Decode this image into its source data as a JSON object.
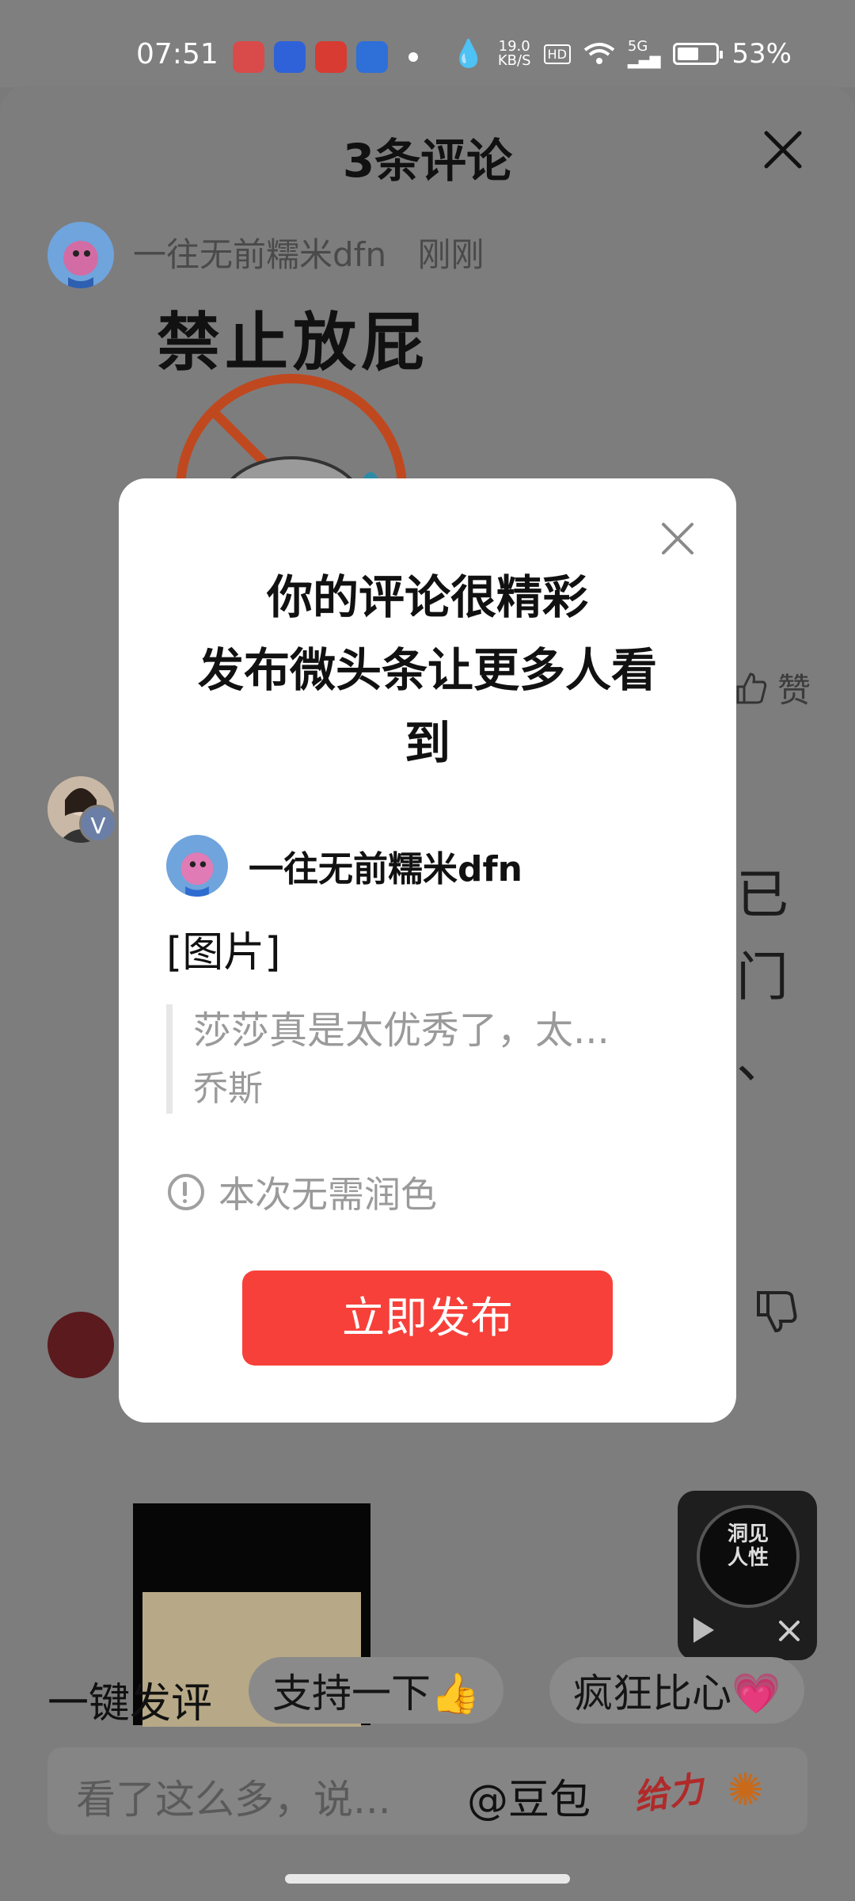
{
  "status_bar": {
    "time": "07:51",
    "net_speed": "19.0",
    "net_speed_unit": "KB/S",
    "hd": "HD",
    "signal": "5G",
    "battery": "53%"
  },
  "sheet": {
    "title": "3条评论",
    "comments": [
      {
        "author": "一往无前糯米dfn",
        "time": "刚刚",
        "sticker_text": "禁止放屁"
      }
    ],
    "like_label": "赞",
    "partial_chars": [
      "已",
      "门",
      "、"
    ]
  },
  "dialog": {
    "title_line1": "你的评论很精彩",
    "title_line2": "发布微头条让更多人看",
    "title_line3": "到",
    "username": "一往无前糯米dfn",
    "content": "[图片]",
    "quote_text": "莎莎真是太优秀了，太...",
    "quote_author": "乔斯",
    "notice": "本次无需润色",
    "publish_button": "立即发布"
  },
  "floating_player": {
    "disc_text_line1": "洞见",
    "disc_text_line2": "人性"
  },
  "quick_reply": {
    "label": "一键发评",
    "chips": [
      "支持一下👍",
      "疯狂比心💗"
    ]
  },
  "input": {
    "placeholder": "看了这么多，说...",
    "mention": "@豆包",
    "give_label": "给力",
    "fireworks_icon": "fireworks-icon"
  },
  "colors": {
    "accent_red": "#f7403a",
    "overlay_gray": "#7d7d7d"
  }
}
